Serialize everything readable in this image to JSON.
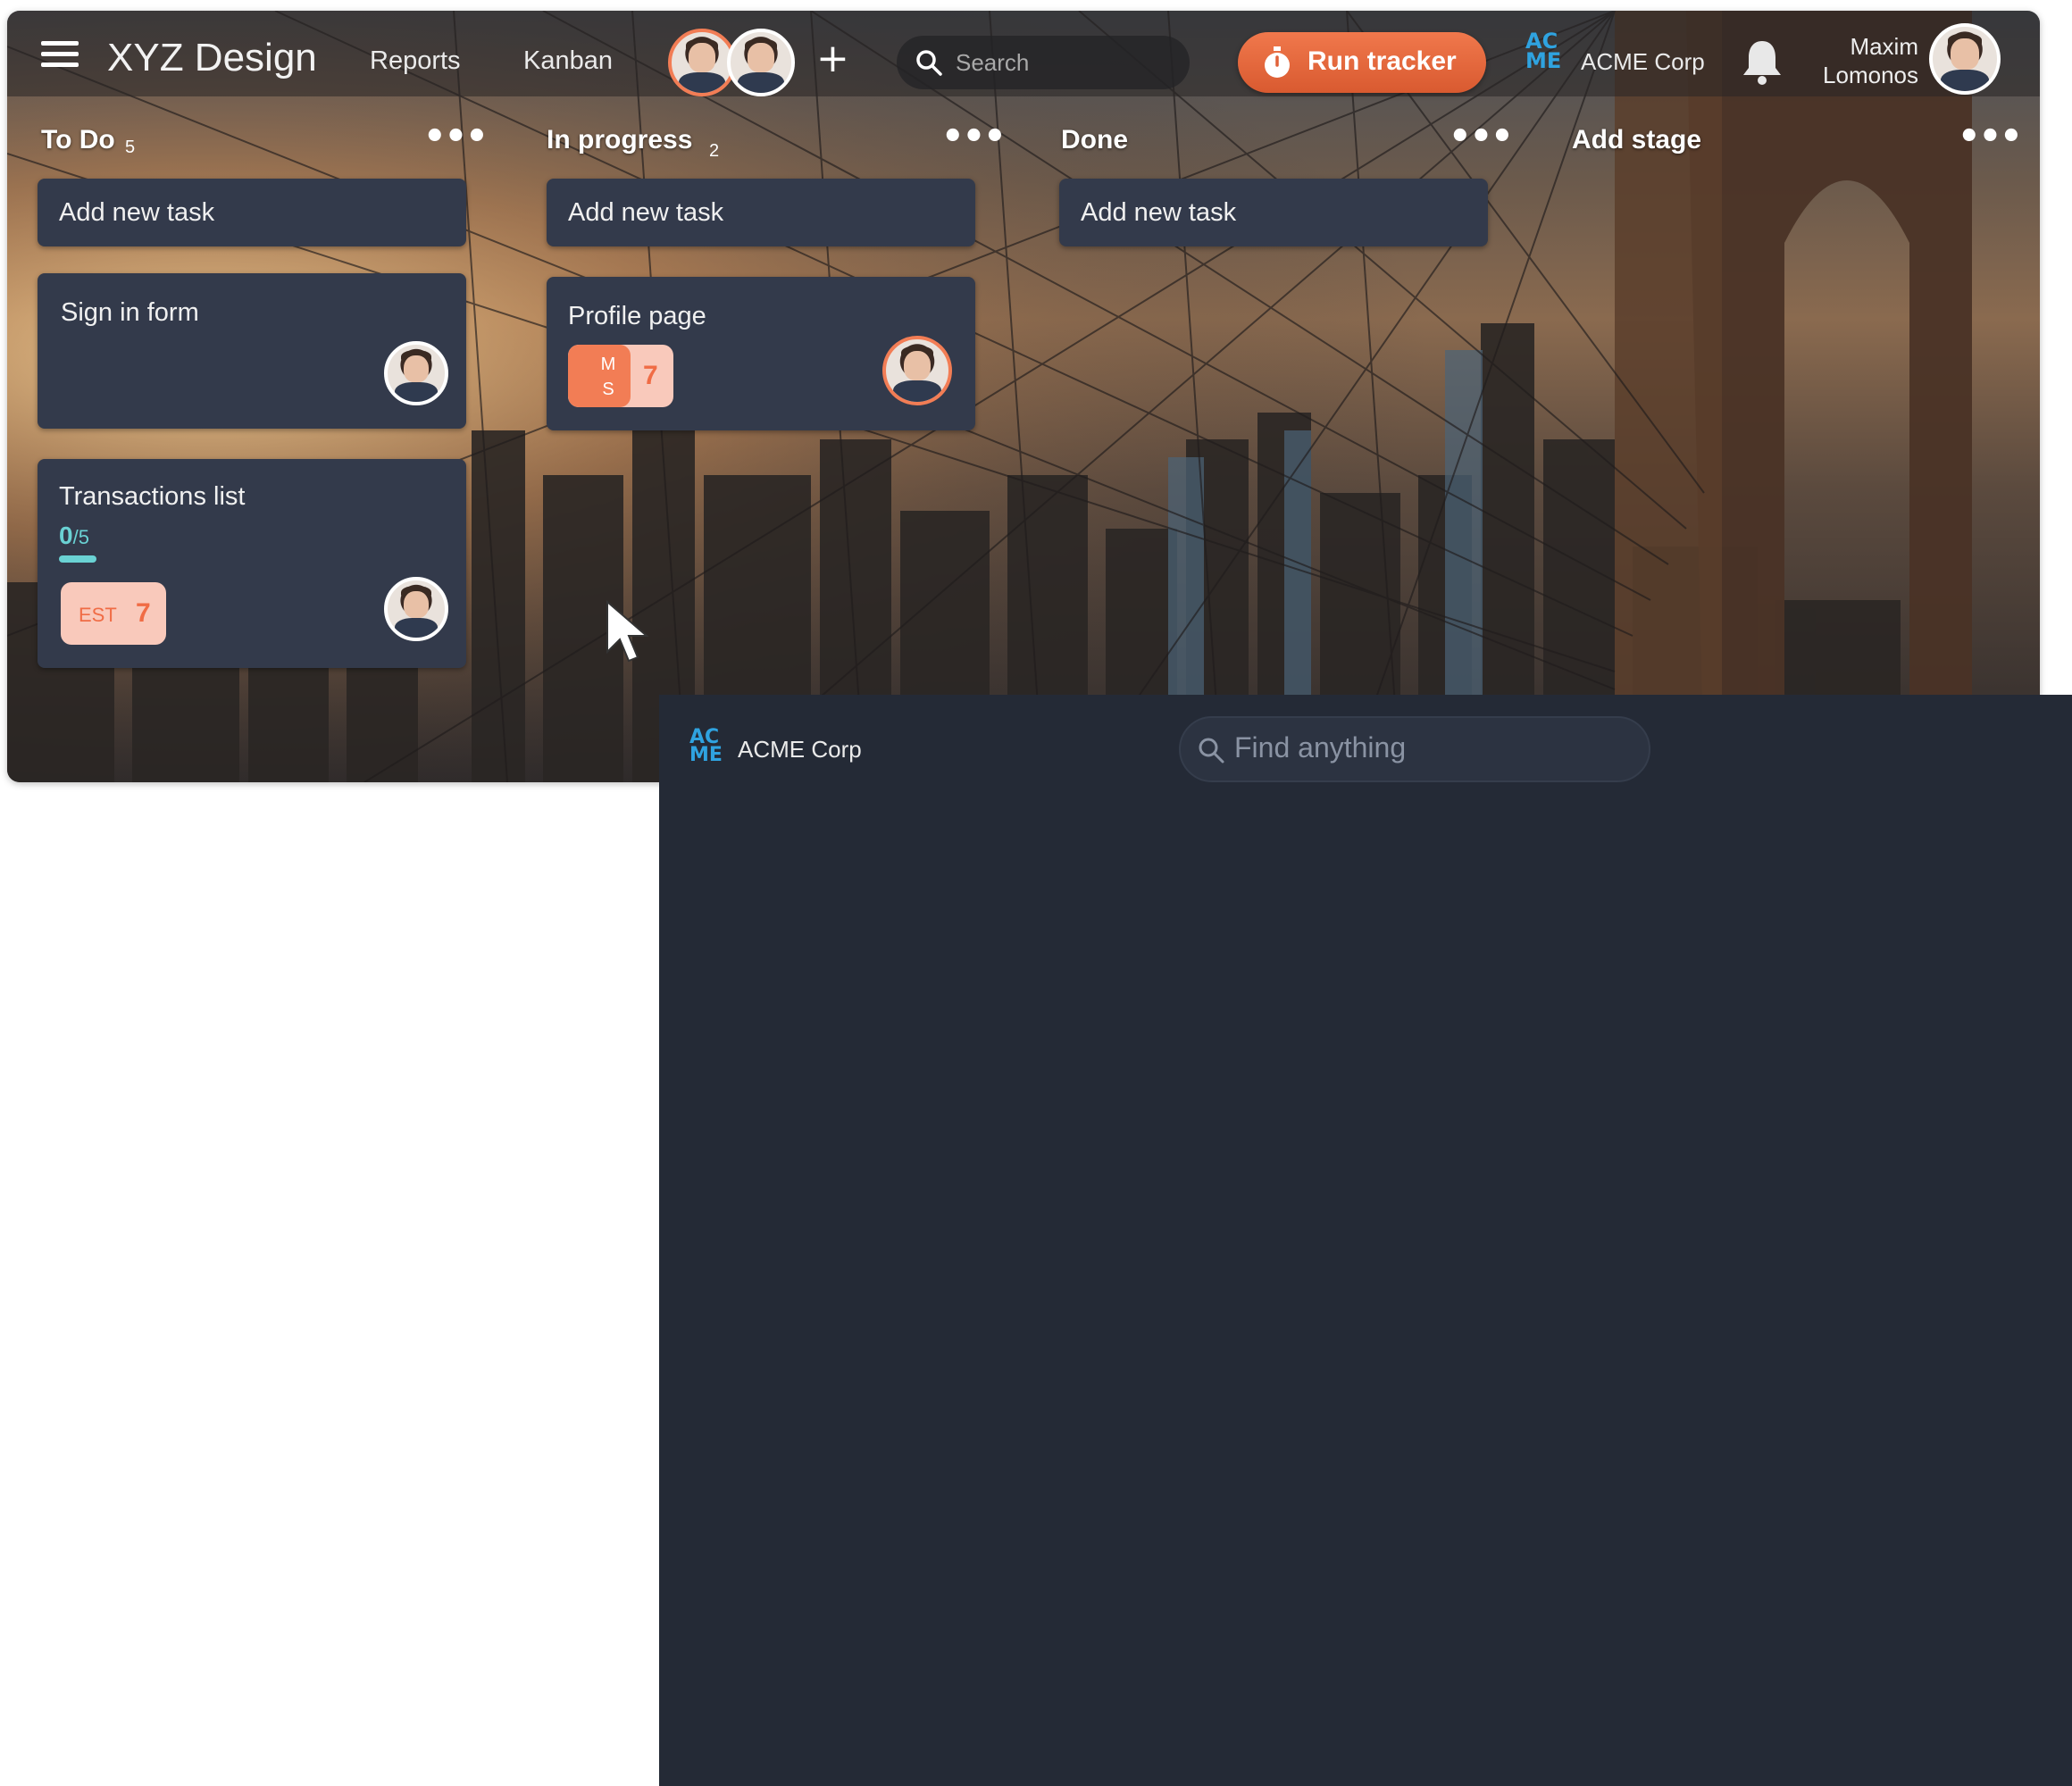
{
  "app": {
    "title": "XYZ Design"
  },
  "nav": {
    "reports": "Reports",
    "kanban": "Kanban"
  },
  "search": {
    "placeholder": "Search"
  },
  "tracker": {
    "label": "Run tracker"
  },
  "org": {
    "logo_line1": "AC",
    "logo_line2": "ME",
    "name": "ACME Corp"
  },
  "user": {
    "first": "Maxim",
    "last": "Lomonos"
  },
  "colors": {
    "accent": "#f27d55",
    "card_bg": "#333a4b",
    "panel_bg": "#242a36",
    "acme_blue": "#2fa3e0",
    "progress": "#6ad2d4"
  },
  "board": {
    "columns": [
      {
        "name": "To Do",
        "count": "5",
        "add_label": "Add new task"
      },
      {
        "name": "In progress",
        "count": "2",
        "add_label": "Add new task"
      },
      {
        "name": "Done",
        "count": "",
        "add_label": "Add new task"
      },
      {
        "name": "Add stage",
        "count": ""
      }
    ],
    "menu_glyph": "•••",
    "cards": {
      "sign_in": {
        "title": "Sign in form"
      },
      "transactions": {
        "title": "Transactions list",
        "progress_done": "0",
        "progress_total": "/5",
        "est_label": "EST",
        "est_value": "7"
      },
      "profile": {
        "title": "Profile page",
        "badge_label_1": "M",
        "badge_label_2": "S",
        "badge_value": "7"
      }
    }
  },
  "panel": {
    "org": {
      "logo_line1": "AC",
      "logo_line2": "ME",
      "name": "ACME Corp"
    },
    "find": {
      "placeholder": "Find anything"
    }
  }
}
